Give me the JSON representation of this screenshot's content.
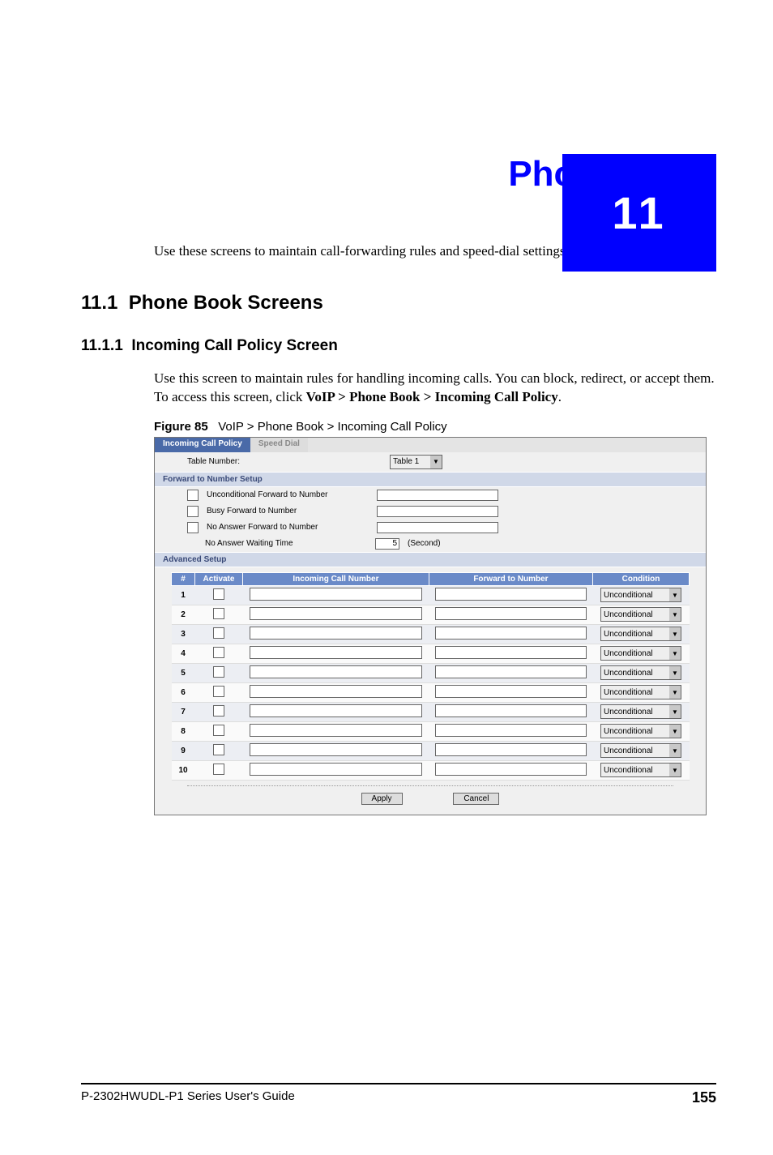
{
  "chapter": {
    "number": "11",
    "title": "Phone Book"
  },
  "intro": "Use these screens to maintain call-forwarding rules and speed-dial settings.",
  "section": {
    "num": "11.1",
    "title": "Phone Book Screens",
    "sub": {
      "num": "11.1.1",
      "title": "Incoming Call Policy Screen"
    }
  },
  "body1": "Use this screen to maintain rules for handling incoming calls. You can block, redirect, or accept them. To access this screen, click ",
  "body1_bold": "VoIP > Phone Book > Incoming Call Policy",
  "body1_end": ".",
  "figure": {
    "label": "Figure 85",
    "caption": "VoIP > Phone Book > Incoming Call Policy"
  },
  "ui": {
    "tabs": {
      "active": "Incoming Call Policy",
      "inactive": "Speed Dial"
    },
    "table_number_label": "Table Number:",
    "table_number_value": "Table 1",
    "section1": "Forward to Number Setup",
    "fwd": {
      "uncond": "Unconditional Forward to Number",
      "busy": "Busy Forward to Number",
      "noans": "No Answer Forward to Number",
      "wait": "No Answer Waiting Time",
      "wait_value": "5",
      "wait_unit": "(Second)"
    },
    "section2": "Advanced Setup",
    "headers": {
      "idx": "#",
      "act": "Activate",
      "incoming": "Incoming Call Number",
      "forward": "Forward to Number",
      "cond": "Condition"
    },
    "condition_value": "Unconditional",
    "rows": [
      1,
      2,
      3,
      4,
      5,
      6,
      7,
      8,
      9,
      10
    ],
    "buttons": {
      "apply": "Apply",
      "cancel": "Cancel"
    }
  },
  "footer": {
    "guide": "P-2302HWUDL-P1 Series User's Guide",
    "page": "155"
  }
}
